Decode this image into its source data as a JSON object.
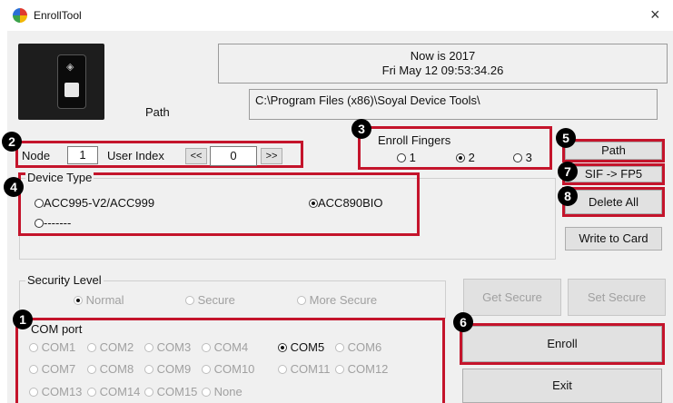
{
  "window": {
    "title": "EnrollTool",
    "close_glyph": "×"
  },
  "now": {
    "line1": "Now is 2017",
    "line2": "Fri May 12 09:53:34.26"
  },
  "path": {
    "label": "Path",
    "value": "C:\\Program Files (x86)\\Soyal Device Tools\\"
  },
  "node": {
    "label": "Node",
    "value": "1",
    "user_index_label": "User Index",
    "prev": "<<",
    "user_index": "0",
    "next": ">>"
  },
  "enroll_fingers": {
    "label": "Enroll Fingers",
    "options": [
      "1",
      "2",
      "3"
    ],
    "selected": "2"
  },
  "device_type": {
    "label": "Device Type",
    "options": [
      "ACC995-V2/ACC999",
      "ACC890BIO",
      "-------"
    ],
    "selected": "ACC890BIO"
  },
  "buttons": {
    "path": "Path",
    "sif_fp5": "SIF -> FP5",
    "delete_all": "Delete All",
    "write_card": "Write to Card",
    "get_secure": "Get Secure",
    "set_secure": "Set Secure",
    "enroll": "Enroll",
    "exit": "Exit"
  },
  "security": {
    "label": "Security Level",
    "options": [
      "Normal",
      "Secure",
      "More Secure"
    ],
    "selected": "Normal"
  },
  "com": {
    "label": "COM port",
    "selected": "COM5",
    "rows": [
      [
        "COM1",
        "COM2",
        "COM3",
        "COM4",
        "COM5",
        "COM6"
      ],
      [
        "COM7",
        "COM8",
        "COM9",
        "COM10",
        "COM11",
        "COM12"
      ],
      [
        "COM13",
        "COM14",
        "COM15",
        "None"
      ]
    ]
  },
  "badges": [
    "1",
    "2",
    "3",
    "4",
    "5",
    "6",
    "7",
    "8"
  ],
  "accent_color": "#c4142b"
}
